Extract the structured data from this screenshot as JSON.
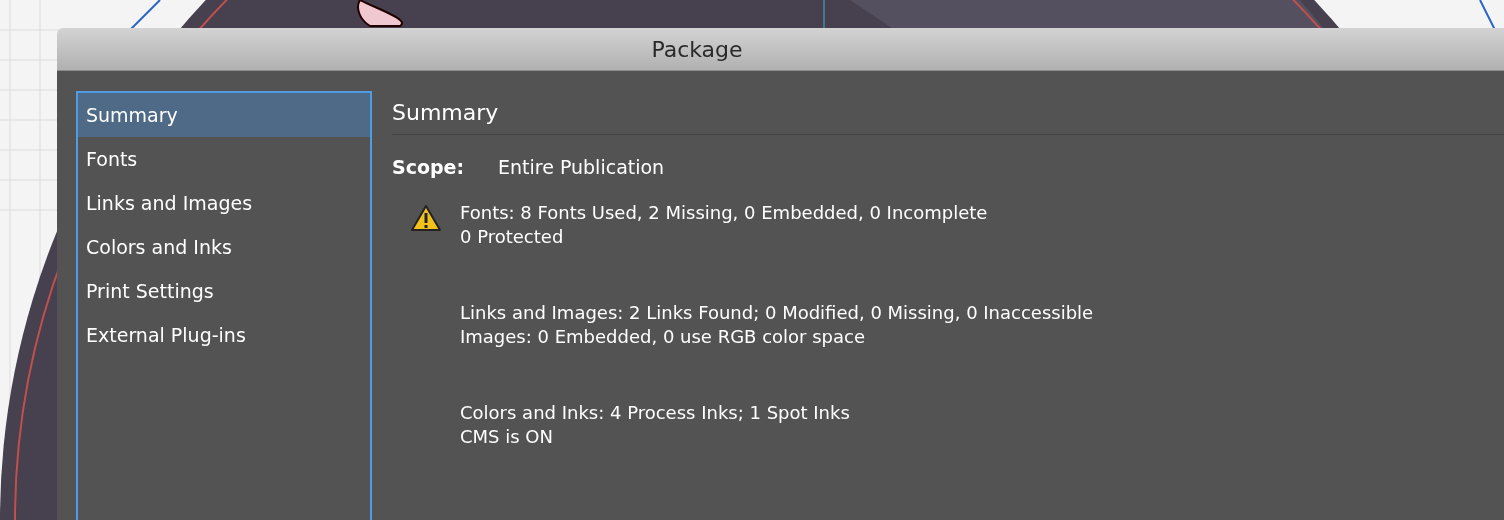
{
  "window": {
    "title": "Package"
  },
  "sidebar": {
    "items": [
      {
        "label": "Summary",
        "selected": true
      },
      {
        "label": "Fonts",
        "selected": false
      },
      {
        "label": "Links and Images",
        "selected": false
      },
      {
        "label": "Colors and Inks",
        "selected": false
      },
      {
        "label": "Print Settings",
        "selected": false
      },
      {
        "label": "External Plug-ins",
        "selected": false
      }
    ]
  },
  "panel": {
    "heading": "Summary",
    "scope_label": "Scope:",
    "scope_value": "Entire Publication",
    "sections": [
      {
        "kind": "warning",
        "lines": [
          "Fonts: 8 Fonts Used, 2 Missing, 0 Embedded, 0 Incomplete",
          "0 Protected"
        ]
      },
      {
        "kind": "ok",
        "lines": [
          "Links and Images: 2 Links Found; 0 Modified, 0 Missing, 0 Inaccessible",
          "Images: 0 Embedded, 0 use RGB color space"
        ]
      },
      {
        "kind": "ok",
        "lines": [
          "Colors and Inks: 4 Process Inks; 1 Spot Inks",
          "CMS is ON"
        ]
      }
    ]
  }
}
